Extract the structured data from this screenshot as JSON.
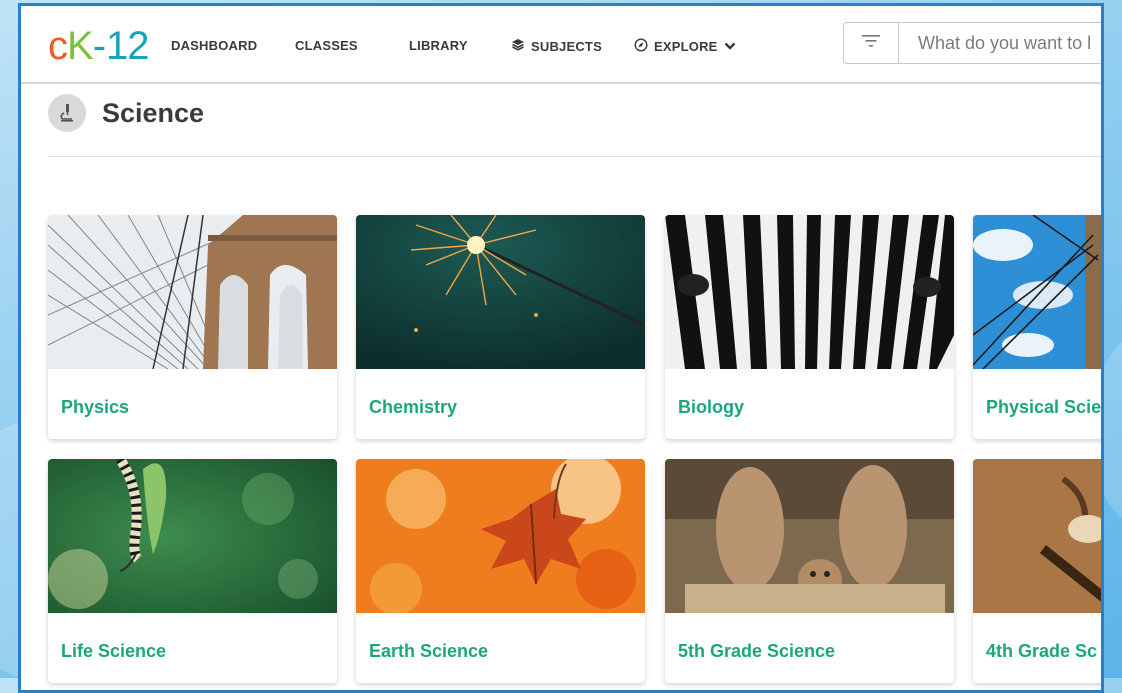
{
  "navbar": {
    "logo": {
      "c": "c",
      "k": "K",
      "dash": "-",
      "num": "12"
    },
    "items": [
      {
        "label": "DASHBOARD",
        "icon": null
      },
      {
        "label": "CLASSES",
        "icon": null
      },
      {
        "label": "LIBRARY",
        "icon": null
      },
      {
        "label": "SUBJECTS",
        "icon": "layers-icon"
      },
      {
        "label": "EXPLORE",
        "icon": "compass-icon"
      }
    ],
    "search": {
      "placeholder": "What do you want to l"
    }
  },
  "subject": {
    "title": "Science",
    "icon": "microscope-icon"
  },
  "cards": [
    {
      "label": "Physics",
      "image": "bridge-cables"
    },
    {
      "label": "Chemistry",
      "image": "sparkler"
    },
    {
      "label": "Biology",
      "image": "zebra-stripes"
    },
    {
      "label": "Physical Scie",
      "image": "power-lines"
    },
    {
      "label": "Life Science",
      "image": "caterpillar-leaf"
    },
    {
      "label": "Earth Science",
      "image": "autumn-leaf"
    },
    {
      "label": "5th Grade Science",
      "image": "meerkats"
    },
    {
      "label": "4th Grade Sc",
      "image": "twig-bird"
    }
  ],
  "colors": {
    "accent": "#1aa77a",
    "frame": "#2b7fc9",
    "logo_orange": "#f05a28",
    "logo_green": "#7ac143",
    "logo_teal": "#1aa3b8"
  }
}
